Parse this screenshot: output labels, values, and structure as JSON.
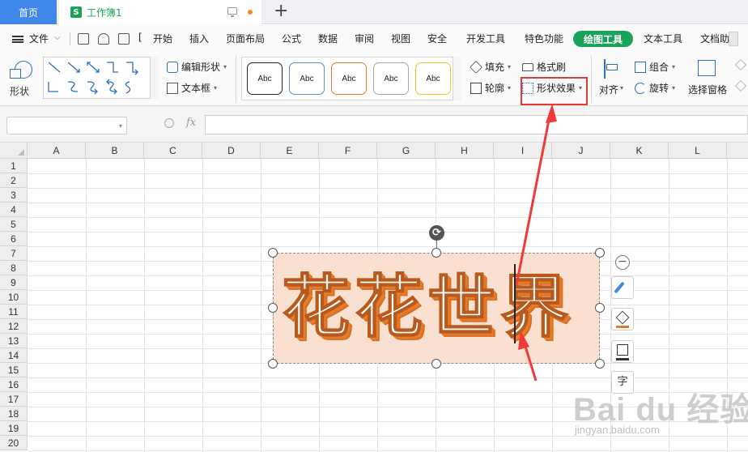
{
  "tabbar": {
    "home_label": "首页",
    "doc_badge": "S",
    "doc_title": "工作簿1",
    "add_label": "+"
  },
  "menu": {
    "file_label": "文件",
    "items": [
      "开始",
      "插入",
      "页面布局",
      "公式",
      "数据",
      "审阅",
      "视图",
      "安全",
      "开发工具",
      "特色功能"
    ],
    "active_label": "绘图工具",
    "after_items": [
      "文本工具",
      "文档助"
    ]
  },
  "ribbon": {
    "shape_label": "形状",
    "edit_shape_label": "编辑形状",
    "textbox_label": "文本框",
    "style_cards": [
      "Abc",
      "Abc",
      "Abc",
      "Abc",
      "Abc"
    ],
    "fill_label": "填充",
    "outline_label": "轮廓",
    "format_painter_label": "格式刷",
    "shape_effect_label": "形状效果",
    "align_label": "对齐",
    "group_label": "组合",
    "rotate_label": "旋转",
    "selection_pane_label": "选择窗格"
  },
  "formula_bar": {
    "fx_label": "fx",
    "formula_value": ""
  },
  "sheet": {
    "columns": [
      "A",
      "B",
      "C",
      "D",
      "E",
      "F",
      "G",
      "H",
      "I",
      "J",
      "K",
      "L"
    ],
    "rows": [
      "1",
      "2",
      "3",
      "4",
      "5",
      "6",
      "7",
      "8",
      "9",
      "10",
      "11",
      "12",
      "13",
      "14",
      "15",
      "16",
      "17",
      "18",
      "19",
      "20"
    ]
  },
  "textbox": {
    "text": "花花世界",
    "fill_color": "#fae0d0",
    "text_outline_color": "#b85a1e",
    "shadow_color": "#e67d2a"
  },
  "float_toolbar": {
    "char_label": "字"
  },
  "colors": {
    "accent_green": "#1aa15a",
    "home_tab_blue": "#3f87e8",
    "highlight_red": "#e53935"
  },
  "watermark": {
    "main": "Bai du 经验",
    "sub": "jingyan.baidu.com"
  }
}
